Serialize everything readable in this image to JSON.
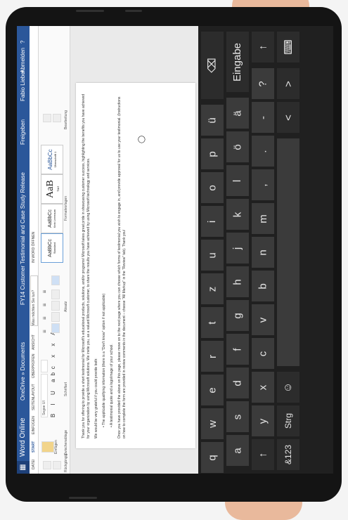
{
  "app": {
    "name": "Word Online",
    "breadcrumb": "OneDrive » Documents",
    "doc_title": "FY14 Customer Testimonial and Case Study Release",
    "share_label": "Freigeben",
    "user": "Fabio Lieber",
    "signout": "Abmelden",
    "help": "?"
  },
  "tabs": [
    "DATEI",
    "START",
    "EINFÜGEN",
    "SEITENLAYOUT",
    "ÜBERPRÜFEN",
    "ANSICHT",
    "Was möchten Sie tun?",
    "IN WORD ÖFFNEN"
  ],
  "ribbon": {
    "groups": [
      "Rückgängig",
      "Zwischenablage",
      "Schriftart",
      "Absatz",
      "Formatvorlagen",
      "Bearbeitung"
    ],
    "paste": "Einfügen",
    "font": "Segoe UI",
    "styles": [
      {
        "sample": "AaBbCc",
        "name": "Standard"
      },
      {
        "sample": "AaBbCc",
        "name": "Kein Leerraum"
      },
      {
        "sample": "AaB",
        "name": "Titel"
      },
      {
        "sample": "AaBbCc",
        "name": "Überschrift 1"
      }
    ]
  },
  "document": {
    "para1": "Thank you for offering to provide a short testimonial for Microsoft's educational products, solutions, and/or programs! Microsoft takes great pride in showcasing customer success, highlighting the benefits you have achieved for your organization by using Microsoft solutions. We invite you, as a valued Microsoft customer, to share the results you have achieved by using Microsoft technology and services.",
    "para2": "We would be very grateful if you could provide both:",
    "bullet1": "The applicable qualifying information (there is a \"Don't know\" option if not applicable)",
    "bullet2": "A testimonial quote and a logo/image of your school.",
    "para3": "Once you have provided the above on this page, please move on to the next page where you can choose which forms of testimonial you wish to engage in, and provide approval for us to use your testimonial. (Instructions on how to complete the form are provided in review comments in the document – choose \"All Markup\" in the \"Review\" tab). Thank you!"
  },
  "keyboard": {
    "rows": [
      [
        "q",
        "w",
        "e",
        "r",
        "t",
        "z",
        "u",
        "i",
        "o",
        "p",
        "ü",
        "⌫"
      ],
      [
        "a",
        "s",
        "d",
        "f",
        "g",
        "h",
        "j",
        "k",
        "l",
        "ö",
        "ä",
        "Eingabe"
      ],
      [
        "↑",
        "y",
        "x",
        "c",
        "v",
        "b",
        "n",
        "m",
        ",",
        ".",
        "-",
        "?",
        "↑"
      ],
      [
        "&123",
        "Strg",
        "☺",
        "",
        "<",
        ">",
        "⌨"
      ]
    ]
  }
}
